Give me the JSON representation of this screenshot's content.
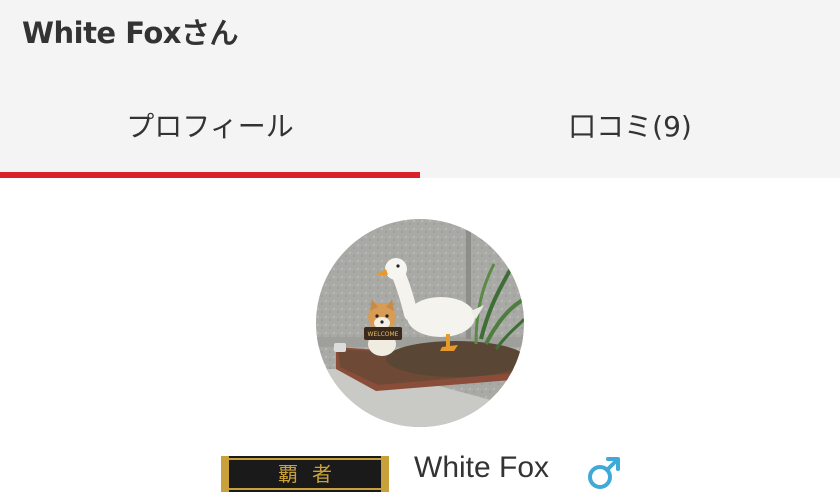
{
  "header": {
    "title": "White Foxさん"
  },
  "tabs": [
    {
      "label": "プロフィール",
      "active": true
    },
    {
      "label": "口コミ(9)",
      "active": false
    }
  ],
  "colors": {
    "accent": "#d8232a",
    "gender_male": "#3fa9d8",
    "header_bg": "#f4f4f4"
  },
  "profile": {
    "username": "White Fox",
    "gender": "male",
    "rank_badge": "覇者",
    "avatar_sign_text": "WELCOME"
  }
}
